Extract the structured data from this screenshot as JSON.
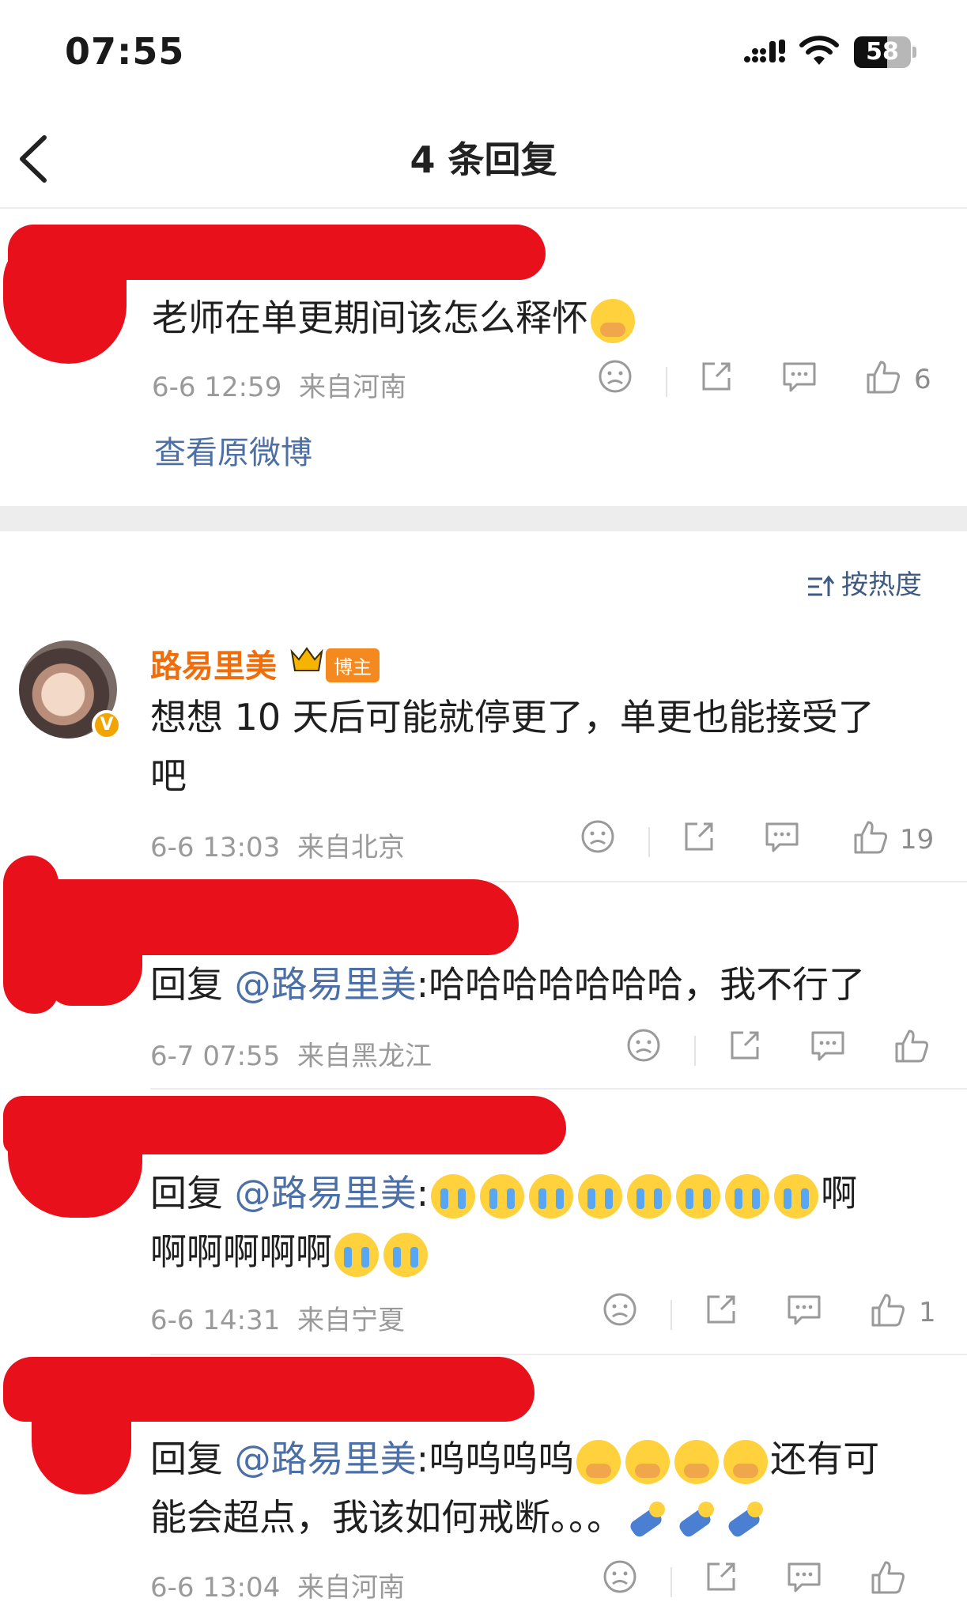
{
  "status_bar": {
    "time": "07:55",
    "battery": "58",
    "battery_level_percent": 58
  },
  "nav": {
    "title": "4 条回复"
  },
  "root_comment": {
    "text": "老师在单更期间该怎么释怀",
    "timestamp": "6-6 12:59",
    "location": "来自河南",
    "likes": "6",
    "view_original": "查看原微博"
  },
  "sort": {
    "label": "按热度"
  },
  "replies": [
    {
      "author": "路易里美",
      "badge": "博主",
      "line1": "想想 10 天后可能就停更了，单更也能接受了",
      "line2": "吧",
      "timestamp": "6-6 13:03",
      "location": "来自北京",
      "likes": "19"
    },
    {
      "reply_prefix": "回复 ",
      "mention": "@路易里美",
      "text": ":哈哈哈哈哈哈哈，我不行了",
      "timestamp": "6-7 07:55",
      "location": "来自黑龙江",
      "likes": ""
    },
    {
      "reply_prefix": "回复 ",
      "mention": "@路易里美",
      "text": ":",
      "text_after": "啊",
      "line2": "啊啊啊啊啊",
      "timestamp": "6-6 14:31",
      "location": "来自宁夏",
      "likes": "1"
    },
    {
      "reply_prefix": "回复 ",
      "mention": "@路易里美",
      "text": ":呜呜呜呜",
      "text_after": "还有可",
      "line2": "能会超点，我该如何戒断。。。",
      "timestamp": "6-6 13:04",
      "location": "来自河南",
      "likes": ""
    }
  ],
  "icons": {
    "emoji_cry": "loudly-crying-face",
    "emoji_cover": "hand-over-mouth-crying",
    "emoji_kneel": "kneeling-person",
    "dislike": "frown-face-icon",
    "share": "share-icon",
    "comment": "comment-icon",
    "like": "thumbs-up-icon"
  },
  "colors": {
    "accent_blue": "#4b6fa6",
    "author_orange": "#f06d0c",
    "redaction_red": "#e8101b"
  }
}
